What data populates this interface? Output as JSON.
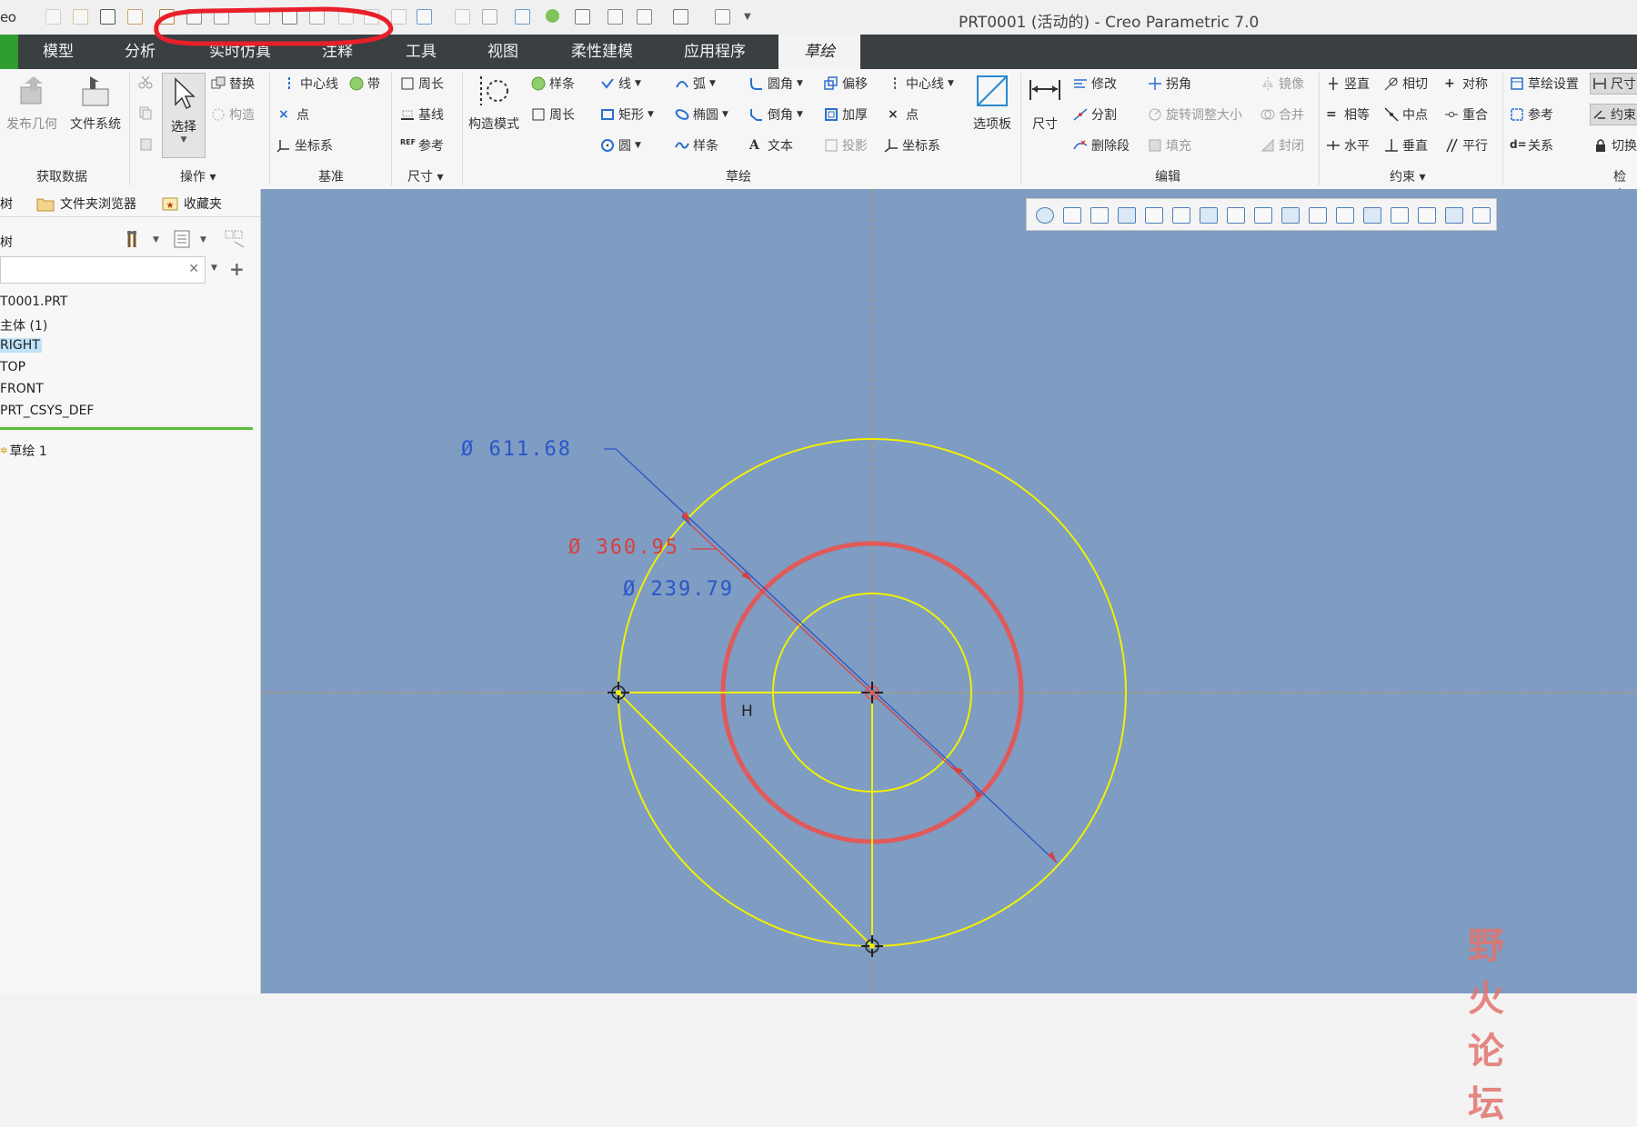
{
  "app": {
    "logo": "eo",
    "window_title": "PRT0001 (活动的) - Creo Parametric 7.0"
  },
  "tabs": [
    "模型",
    "分析",
    "实时仿真",
    "注释",
    "工具",
    "视图",
    "柔性建模",
    "应用程序",
    "草绘"
  ],
  "active_tab": "草绘",
  "ribbon": {
    "get_data": {
      "label": "获取数据",
      "items": [
        "发布几何",
        "文件系统"
      ]
    },
    "operations": {
      "label": "操作",
      "select": "选择",
      "items": [
        "替换",
        "构造"
      ]
    },
    "datum": {
      "label": "基准",
      "items": [
        "中心线",
        "带",
        "点",
        "坐标系"
      ]
    },
    "dimension": {
      "label": "尺寸",
      "items": [
        "周长",
        "基线",
        "参考"
      ]
    },
    "sketch": {
      "label": "草绘",
      "construction_mode": "构造模式",
      "items": [
        "样条",
        "周长",
        "线",
        "弧",
        "圆角",
        "偏移",
        "中心线",
        "矩形",
        "椭圆",
        "倒角",
        "加厚",
        "点",
        "圆",
        "样条",
        "文本",
        "投影",
        "坐标系"
      ],
      "palette": "选项板"
    },
    "edit": {
      "label": "编辑",
      "dim": "尺寸",
      "items": [
        "修改",
        "拐角",
        "镜像",
        "分割",
        "旋转调整大小",
        "合并",
        "删除段",
        "填充",
        "封闭"
      ]
    },
    "constrain": {
      "label": "约束",
      "items": [
        "竖直",
        "相切",
        "对称",
        "相等",
        "中点",
        "重合",
        "水平",
        "垂直",
        "平行"
      ]
    },
    "inspect": {
      "label": "检查",
      "items": [
        "草绘设置",
        "参考",
        "关系"
      ],
      "cut": [
        "尺寸",
        "约束",
        "切换"
      ]
    }
  },
  "left_panel": {
    "tabs": [
      "树",
      "文件夹浏览器",
      "收藏夹"
    ],
    "tree_label": "树",
    "search_placeholder": "",
    "tree": [
      "T0001.PRT",
      "主体 (1)",
      "RIGHT",
      "TOP",
      "FRONT",
      "PRT_CSYS_DEF"
    ],
    "selected": "RIGHT",
    "sketch_item": "草绘 1"
  },
  "canvas": {
    "dimensions": [
      {
        "text": "Ø 611.68",
        "color": "#2a56c8"
      },
      {
        "text": "Ø 360.95",
        "color": "#d84040"
      },
      {
        "text": "Ø 239.79",
        "color": "#2a56c8"
      }
    ],
    "constraint_label": "H",
    "colors": {
      "background": "#7f9cc2",
      "geometry": "#f0f000",
      "highlight": "#e05a5a",
      "centerline": "#c89a5a"
    }
  },
  "watermark": {
    "text": "野火论坛"
  }
}
